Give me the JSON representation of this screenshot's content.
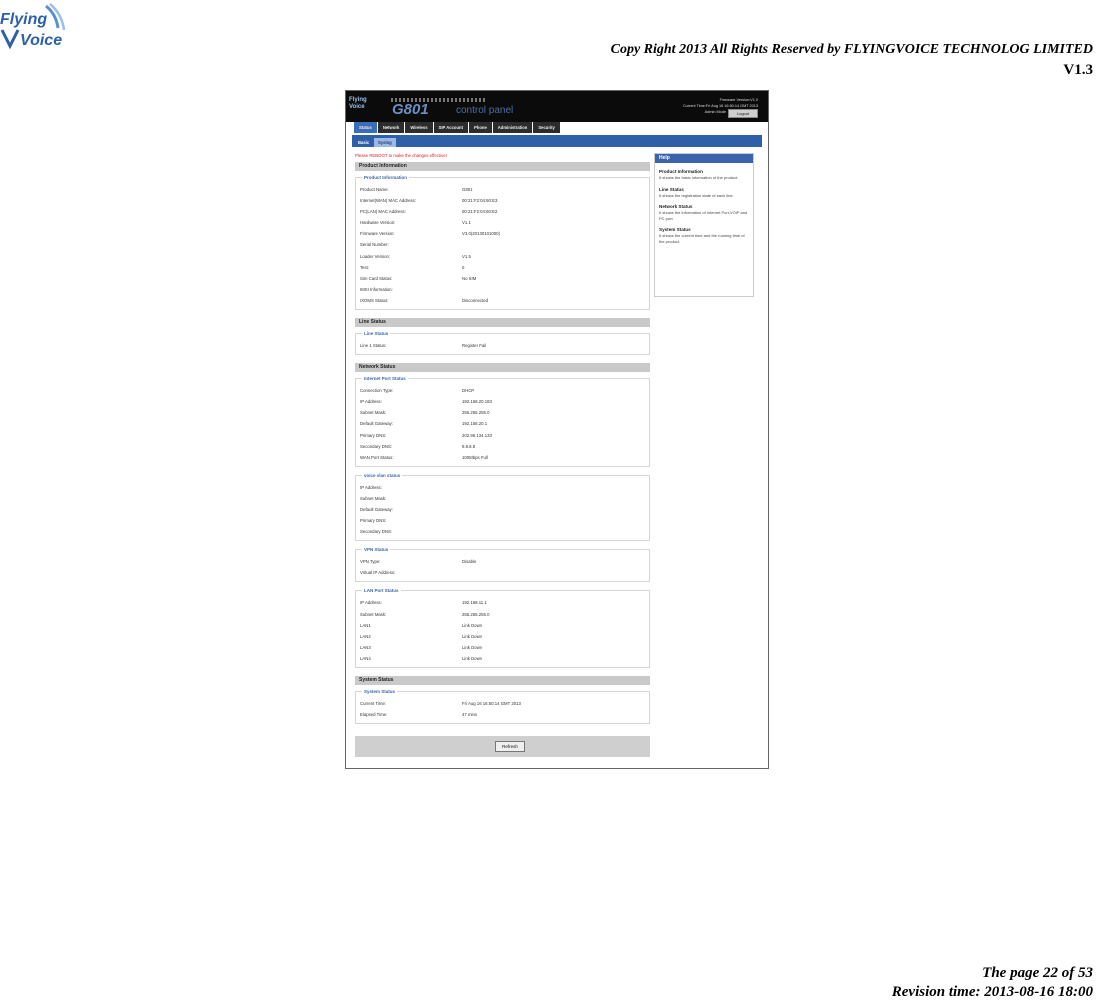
{
  "doc": {
    "logo_top": "Flying",
    "logo_bottom": "Voice",
    "copyright": "Copy Right 2013 All Rights Reserved by FLYINGVOICE TECHNOLOG LIMITED",
    "version": "V1.3",
    "page": "The page 22 of 53",
    "revision": "Revision time: 2013-08-16 18:00"
  },
  "panel": {
    "logo_top": "Flying",
    "logo_bottom": "Voice",
    "model": "G801",
    "title": "control panel",
    "firmware": "Firmware Version:V1.0",
    "current_time": "Current Time:Fri Aug 16 16:50:14 GMT 2013",
    "mode": "Admin Mode",
    "logout": "Logout"
  },
  "tabs": [
    "Status",
    "Network",
    "Wireless",
    "SIP Account",
    "Phone",
    "Administration",
    "Security"
  ],
  "subtabs": [
    "Basic",
    "Syslog"
  ],
  "notice": "Please REBOOT to make the changes effective!",
  "sections": {
    "product": {
      "header": "Product Information",
      "group": "Product Information",
      "rows": [
        {
          "label": "Product Name:",
          "value": "G801"
        },
        {
          "label": "Internet(WAN) MAC Address:",
          "value": "00:21:F2:04:60:E3"
        },
        {
          "label": "PC(LAN) MAC Address:",
          "value": "00:21:F2:04:60:E2"
        },
        {
          "label": "Hardware Version:",
          "value": "V1.1"
        },
        {
          "label": "Firmware Version:",
          "value": "V3.0(20130101000)"
        },
        {
          "label": "Serial Number:",
          "value": ""
        },
        {
          "label": "Loader Version:",
          "value": "V1.5"
        },
        {
          "label": "Test:",
          "value": "0"
        },
        {
          "label": "Sim Card Status:",
          "value": "No SIM"
        },
        {
          "label": "IMSI Information:",
          "value": ""
        },
        {
          "label": "IXOMS Status:",
          "value": "Disconnected"
        }
      ]
    },
    "line": {
      "header": "Line Status",
      "group": "Line Status",
      "rows": [
        {
          "label": "Line 1 Status:",
          "value": "Register Fail"
        }
      ]
    },
    "network": {
      "header": "Network Status",
      "internet": {
        "group": "Internet Port Status",
        "rows": [
          {
            "label": "Connection Type:",
            "value": "DHCP"
          },
          {
            "label": "IP Address:",
            "value": "192.168.20.183"
          },
          {
            "label": "Subnet Mask:",
            "value": "255.255.255.0"
          },
          {
            "label": "Default Gateway:",
            "value": "192.168.20.1"
          },
          {
            "label": "Primary DNS:",
            "value": "202.96.134.133"
          },
          {
            "label": "Secondary DNS:",
            "value": "8.8.8.8"
          },
          {
            "label": "WAN Port Status:",
            "value": "100Mbps Full"
          }
        ]
      },
      "voicevlan": {
        "group": "voice vlan status",
        "rows": [
          {
            "label": "IP Address:",
            "value": ""
          },
          {
            "label": "Subnet Mask:",
            "value": ""
          },
          {
            "label": "Default Gateway:",
            "value": ""
          },
          {
            "label": "Primary DNS:",
            "value": ""
          },
          {
            "label": "Secondary DNS:",
            "value": ""
          }
        ]
      },
      "vpn": {
        "group": "VPN Status",
        "rows": [
          {
            "label": "VPN Type:",
            "value": "Disable"
          },
          {
            "label": "Virtual IP Address:",
            "value": ""
          }
        ]
      },
      "lan": {
        "group": "LAN Port Status",
        "rows": [
          {
            "label": "IP Address:",
            "value": "192.168.11.1"
          },
          {
            "label": "Subnet Mask:",
            "value": "255.255.255.0"
          },
          {
            "label": "LAN1",
            "value": "Link Down"
          },
          {
            "label": "LAN2",
            "value": "Link Down"
          },
          {
            "label": "LAN3",
            "value": "Link Down"
          },
          {
            "label": "LAN4",
            "value": "Link Down"
          }
        ]
      }
    },
    "system": {
      "header": "System Status",
      "group": "System Status",
      "rows": [
        {
          "label": "Current Time:",
          "value": "Fri Aug 16 16:50:14 GMT 2013"
        },
        {
          "label": "Elapsed Time:",
          "value": "47 mins"
        }
      ]
    }
  },
  "refresh": "Refresh",
  "help": {
    "header": "Help",
    "items": [
      {
        "title": "Product Information",
        "text": "It shows the basic information of the product."
      },
      {
        "title": "Line Status",
        "text": "It shows the registration state of each line."
      },
      {
        "title": "Network Status",
        "text": "It shows the information of Internet Port,VOIP and PC port."
      },
      {
        "title": "System Status",
        "text": "It shows the current time and the running time of the product."
      }
    ]
  }
}
